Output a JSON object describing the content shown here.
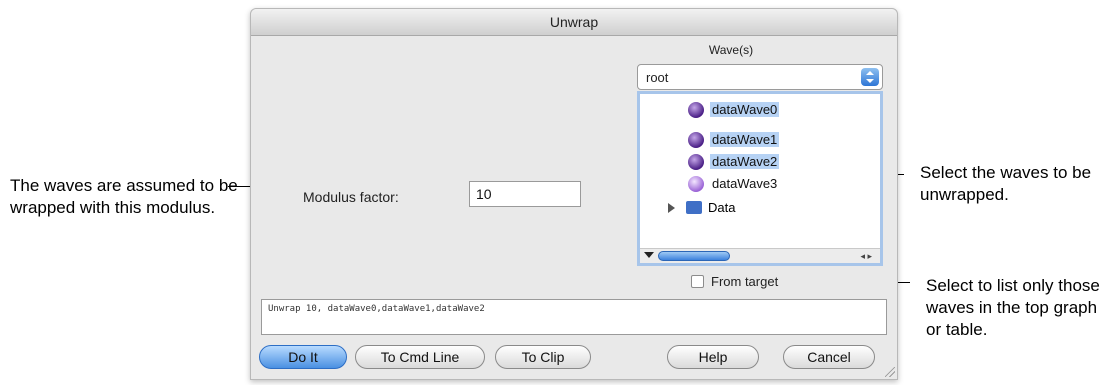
{
  "dialog": {
    "title": "Unwrap",
    "modulus_label": "Modulus factor:",
    "modulus_value": "10",
    "wave_label": "Wave(s)",
    "folder_popup": "root",
    "waves": [
      {
        "name": "dataWave0",
        "selected": true
      },
      {
        "name": "dataWave1",
        "selected": true
      },
      {
        "name": "dataWave2",
        "selected": true
      },
      {
        "name": "dataWave3",
        "selected": false
      }
    ],
    "data_folder": "Data",
    "from_target_label": "From target",
    "from_target_checked": false,
    "command_line": "Unwrap 10, dataWave0,dataWave1,dataWave2",
    "buttons": {
      "do_it": "Do It",
      "to_cmd_line": "To Cmd Line",
      "to_clip": "To Clip",
      "help": "Help",
      "cancel": "Cancel"
    }
  },
  "callouts": {
    "modulus": "The waves are assumed to be wrapped with this modulus.",
    "waves": "Select the waves to be unwrapped.",
    "from_target": "Select to list only those waves in the top graph or table."
  },
  "colors": {
    "selection": "#b6d2f4",
    "default_button": "#4a90e2",
    "wave_icon": "#4a1f86"
  }
}
